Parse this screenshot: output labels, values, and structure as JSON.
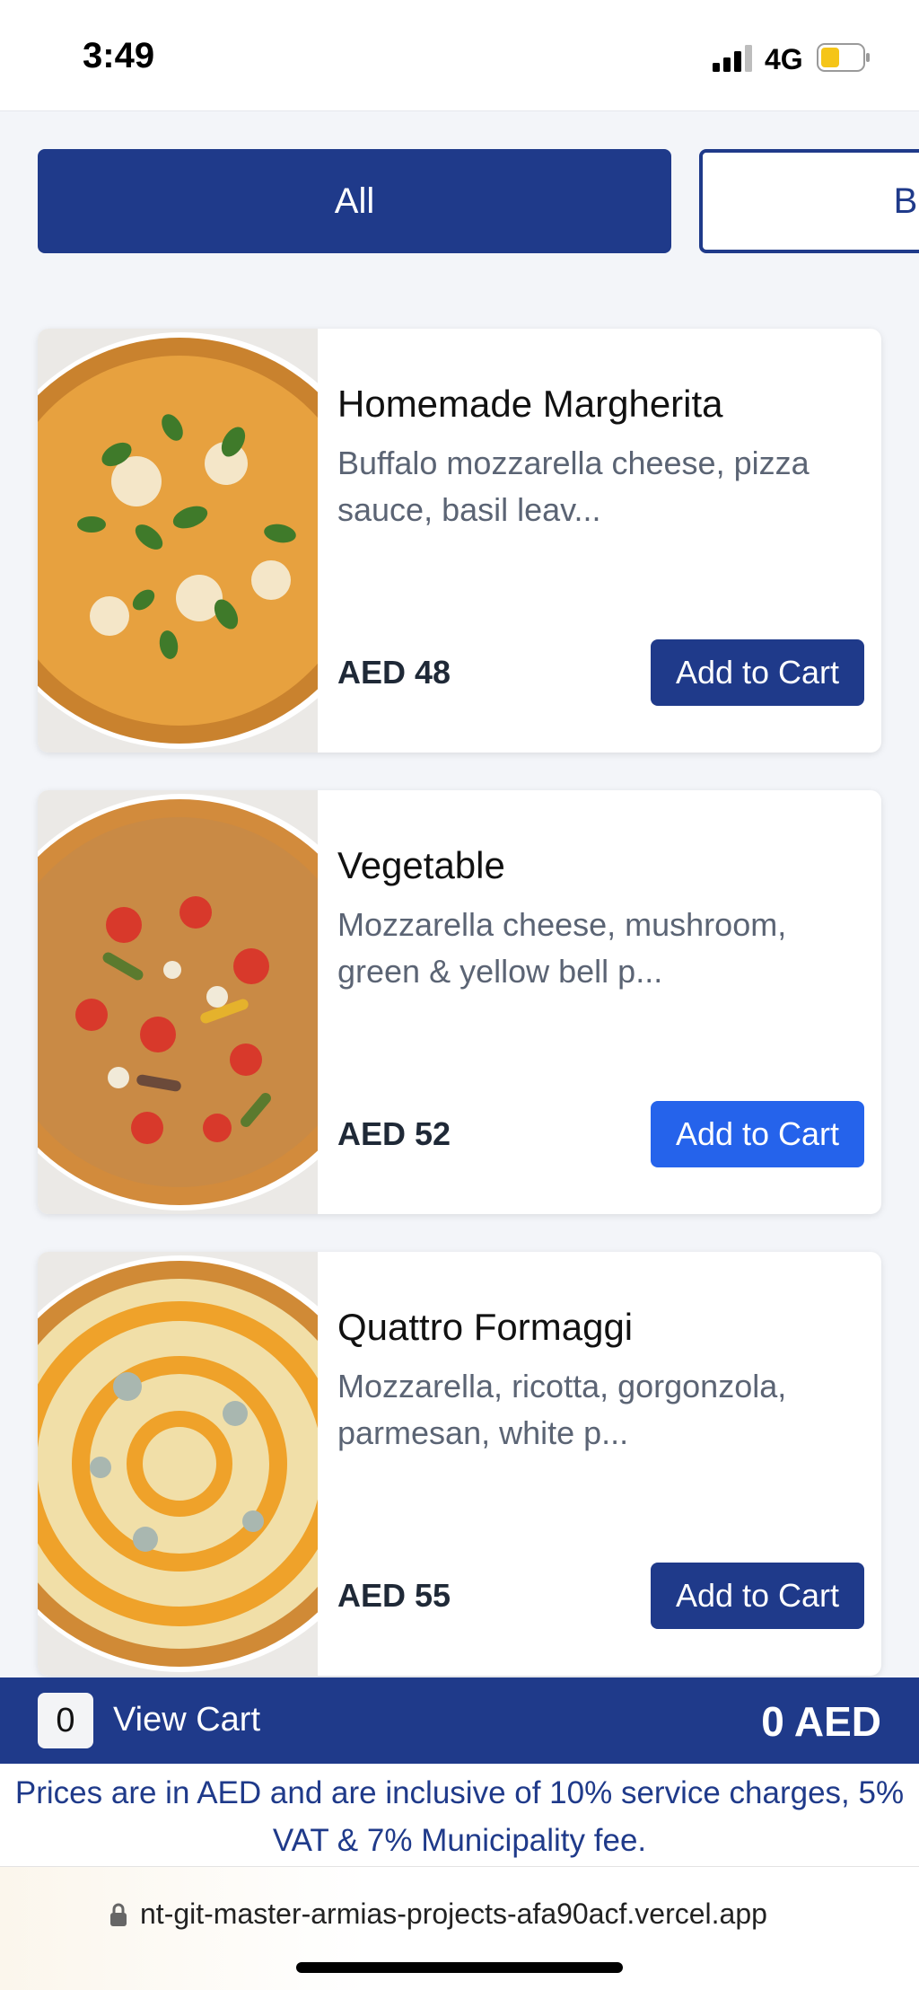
{
  "status_bar": {
    "time": "3:49",
    "network": "4G",
    "battery_color": "#f5c518"
  },
  "tabs": [
    {
      "label": "All",
      "active": true
    },
    {
      "label": "B",
      "active": false
    }
  ],
  "products": [
    {
      "name": "Homemade Margherita",
      "description": "Buffalo mozzarella cheese, pizza sauce, basil leav...",
      "price": "AED 48",
      "button_label": "Add to Cart",
      "button_color": "#1f3a8a"
    },
    {
      "name": "Vegetable",
      "description": "Mozzarella cheese, mushroom, green & yellow bell p...",
      "price": "AED 52",
      "button_label": "Add to Cart",
      "button_color": "#2563eb"
    },
    {
      "name": "Quattro Formaggi",
      "description": "Mozzarella, ricotta, gorgonzola, parmesan, white p...",
      "price": "AED 55",
      "button_label": "Add to Cart",
      "button_color": "#1f3a8a"
    }
  ],
  "cart": {
    "count": "0",
    "label": "View Cart",
    "total": "0 AED"
  },
  "notice": "Prices are in AED and are inclusive of 10% service charges, 5% VAT & 7% Municipality fee.",
  "browser": {
    "url": "nt-git-master-armias-projects-afa90acf.vercel.app"
  },
  "colors": {
    "primary": "#1f3a8a",
    "accent": "#2563eb"
  }
}
